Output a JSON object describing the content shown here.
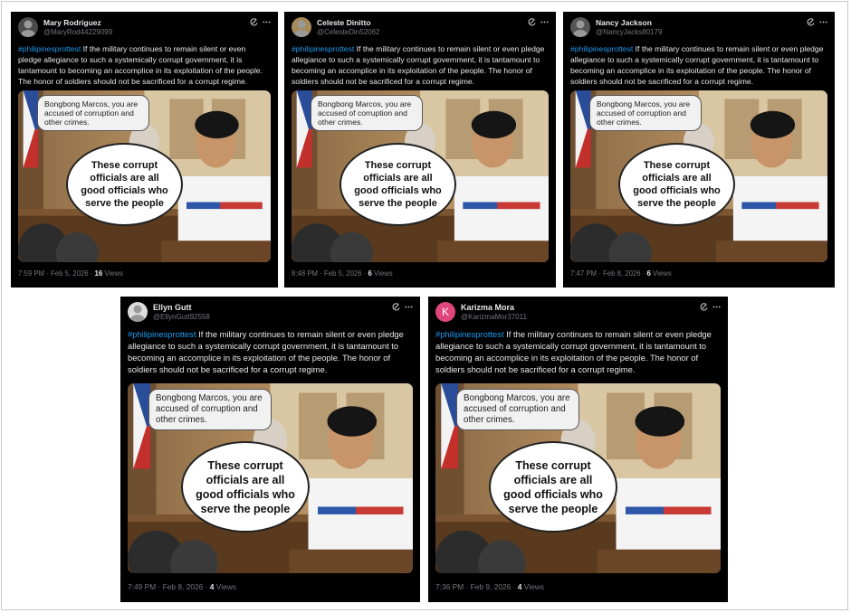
{
  "post_text": {
    "hashtag": "#philipinesprottest",
    "body": " If the military continues to remain silent or even pledge allegiance to such a systemically corrupt government, it is tantamount to becoming an accomplice in its exploitation of the people. The honor of soldiers should not be sacrificed for a corrupt regime."
  },
  "image_text": {
    "small_bubble": "Bongbong Marcos, you are accused of corruption and other crimes.",
    "big_bubble": "These corrupt officials are all good officials who serve the people"
  },
  "posts": [
    {
      "name": "Mary Rodriguez",
      "handle": "@MaryRod44229099",
      "time": "7:59 PM · Feb 5, 2026 · ",
      "views": "16",
      "views_label": " Views",
      "avatar_color": "#4a4a4a",
      "avatar_letter": ""
    },
    {
      "name": "Celeste Dinitto",
      "handle": "@CelesteDin52062",
      "time": "8:48 PM · Feb 5, 2026 · ",
      "views": "6",
      "views_label": " Views",
      "avatar_color": "#a78a5a",
      "avatar_letter": ""
    },
    {
      "name": "Nancy Jackson",
      "handle": "@NancyJacks80179",
      "time": "7:47 PM · Feb 8, 2026 · ",
      "views": "6",
      "views_label": " Views",
      "avatar_color": "#555555",
      "avatar_letter": ""
    },
    {
      "name": "Ellyn Gutt",
      "handle": "@EllynGutt92558",
      "time": "7:49 PM · Feb 8, 2026 · ",
      "views": "4",
      "views_label": " Views",
      "avatar_color": "#dddddd",
      "avatar_letter": ""
    },
    {
      "name": "Karizma Mora",
      "handle": "@KarizmaMor37011",
      "time": "7:36 PM · Feb 9, 2026 · ",
      "views": "4",
      "views_label": " Views",
      "avatar_color": "#e0457b",
      "avatar_letter": "K"
    }
  ],
  "colors": {
    "background": "#000000",
    "hashtag": "#1d9bf0",
    "secondary": "#71767b",
    "primary": "#e7e9ea"
  },
  "icons": [
    "grok-icon",
    "more-icon"
  ]
}
